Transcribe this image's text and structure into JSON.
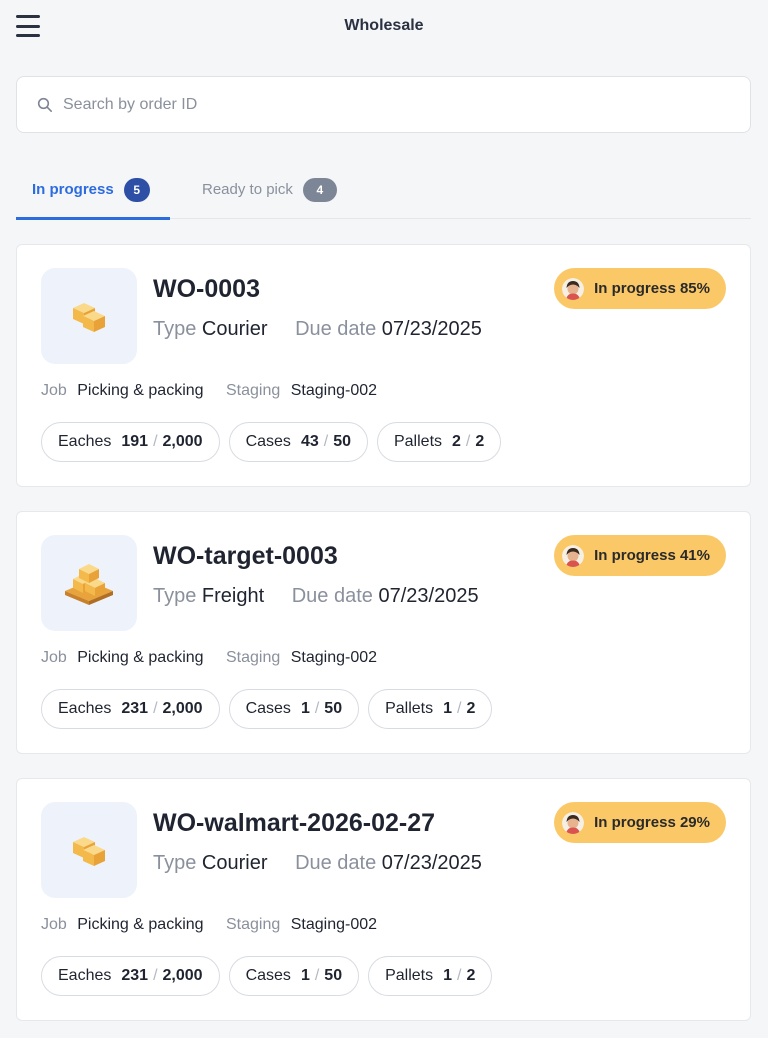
{
  "header": {
    "title": "Wholesale"
  },
  "search": {
    "placeholder": "Search by order ID"
  },
  "tabs": [
    {
      "label": "In progress",
      "count": "5"
    },
    {
      "label": "Ready to pick",
      "count": "4"
    }
  ],
  "labels": {
    "type": "Type",
    "due": "Due date",
    "job": "Job",
    "staging": "Staging"
  },
  "orders": [
    {
      "id": "WO-0003",
      "type": "Courier",
      "due": "07/23/2025",
      "status": "In progress 85%",
      "status_progress": 0.85,
      "job": "Picking & packing",
      "staging": "Staging-002",
      "eaches": {
        "label": "Eaches",
        "done": "191",
        "total": "2,000"
      },
      "cases": {
        "label": "Cases",
        "done": "43",
        "total": "50"
      },
      "pallets": {
        "label": "Pallets",
        "done": "2",
        "total": "2"
      }
    },
    {
      "id": "WO-target-0003",
      "type": "Freight",
      "due": "07/23/2025",
      "status": "In progress 41%",
      "status_progress": 0.41,
      "job": "Picking & packing",
      "staging": "Staging-002",
      "eaches": {
        "label": "Eaches",
        "done": "231",
        "total": "2,000"
      },
      "cases": {
        "label": "Cases",
        "done": "1",
        "total": "50"
      },
      "pallets": {
        "label": "Pallets",
        "done": "1",
        "total": "2"
      }
    },
    {
      "id": "WO-walmart-2026-02-27",
      "type": "Courier",
      "due": "07/23/2025",
      "status": "In progress 29%",
      "status_progress": 0.29,
      "job": "Picking & packing",
      "staging": "Staging-002",
      "eaches": {
        "label": "Eaches",
        "done": "231",
        "total": "2,000"
      },
      "cases": {
        "label": "Cases",
        "done": "1",
        "total": "50"
      },
      "pallets": {
        "label": "Pallets",
        "done": "1",
        "total": "2"
      }
    }
  ],
  "icons": {
    "menu": "hamburger-icon",
    "search": "search-icon",
    "courier": "boxes-icon",
    "freight": "pallet-boxes-icon",
    "avatar": "user-avatar"
  },
  "colors": {
    "accent": "#2d6cdf",
    "status_bg": "#fbc868",
    "badge_active": "#2d4fa6",
    "badge_inactive": "#7d8696"
  }
}
